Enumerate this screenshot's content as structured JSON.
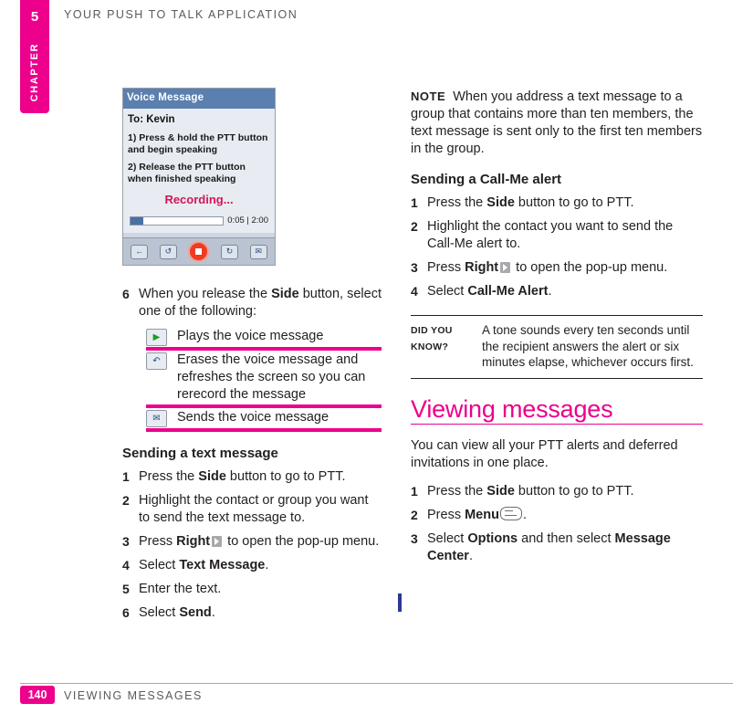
{
  "chapter": {
    "number": "5",
    "word": "CHAPTER"
  },
  "running_head": "Your Push To Talk Application",
  "figure": {
    "titlebar": "Voice Message",
    "to_line": "To: Kevin",
    "step1": "1) Press & hold the PTT button and begin speaking",
    "step2": "2) Release the PTT button when finished speaking",
    "recording_label": "Recording...",
    "time": "0:05 | 2:00",
    "buttons": [
      "back-button",
      "rewind-button",
      "record-button",
      "forward-button",
      "mail-button"
    ]
  },
  "left": {
    "step6": {
      "num": "6",
      "text_a": "When you release the ",
      "bold": "Side",
      "text_b": " button, select one of the following:"
    },
    "icon_rows": [
      {
        "icon": "play-icon",
        "glyph": "▶",
        "desc": "Plays the voice message"
      },
      {
        "icon": "erase-icon",
        "glyph": "↶",
        "desc": "Erases the voice message and refreshes the screen so you can rerecord the message"
      },
      {
        "icon": "send-icon",
        "glyph": "✉",
        "desc": "Sends the voice message"
      }
    ],
    "heading": "Sending a text message",
    "steps": [
      {
        "num": "1",
        "parts": [
          {
            "t": "Press the "
          },
          {
            "b": "Side"
          },
          {
            "t": " button to go to PTT."
          }
        ]
      },
      {
        "num": "2",
        "parts": [
          {
            "t": "Highlight the contact or group you want to send the text message to."
          }
        ]
      },
      {
        "num": "3",
        "parts": [
          {
            "t": "Press "
          },
          {
            "b": "Right"
          },
          {
            "icon": "nav-right-icon"
          },
          {
            "t": " to open the pop-up menu."
          }
        ]
      },
      {
        "num": "4",
        "parts": [
          {
            "t": "Select "
          },
          {
            "b": "Text Message"
          },
          {
            "t": "."
          }
        ]
      },
      {
        "num": "5",
        "parts": [
          {
            "t": "Enter the text."
          }
        ]
      },
      {
        "num": "6",
        "parts": [
          {
            "t": "Select "
          },
          {
            "b": "Send"
          },
          {
            "t": "."
          }
        ]
      }
    ]
  },
  "right": {
    "note_label": "NOTE",
    "note_text": "When you address a text message to a group that contains more than ten members, the text message is sent only to the first ten members in the group.",
    "heading": "Sending a Call-Me alert",
    "steps": [
      {
        "num": "1",
        "parts": [
          {
            "t": "Press the "
          },
          {
            "b": "Side"
          },
          {
            "t": " button to go to PTT."
          }
        ]
      },
      {
        "num": "2",
        "parts": [
          {
            "t": "Highlight the contact you want to send the Call-Me alert to."
          }
        ]
      },
      {
        "num": "3",
        "parts": [
          {
            "t": "Press "
          },
          {
            "b": "Right"
          },
          {
            "icon": "nav-right-icon"
          },
          {
            "t": " to open the pop-up menu."
          }
        ]
      },
      {
        "num": "4",
        "parts": [
          {
            "t": "Select "
          },
          {
            "b": "Call-Me Alert"
          },
          {
            "t": "."
          }
        ]
      }
    ],
    "tip_label": "DID YOU KNOW?",
    "tip_text": "A tone sounds every ten seconds until the recipient answers the alert or six minutes elapse, whichever occurs first.",
    "major_heading": "Viewing messages",
    "intro": "You can view all your PTT alerts and deferred invitations in one place.",
    "steps2": [
      {
        "num": "1",
        "parts": [
          {
            "t": "Press the "
          },
          {
            "b": "Side"
          },
          {
            "t": " button to go to PTT."
          }
        ]
      },
      {
        "num": "2",
        "parts": [
          {
            "t": "Press "
          },
          {
            "b": "Menu"
          },
          {
            "icon": "menu-key-icon"
          },
          {
            "t": "."
          }
        ]
      },
      {
        "num": "3",
        "parts": [
          {
            "t": "Select "
          },
          {
            "b": "Options"
          },
          {
            "t": " and then select "
          },
          {
            "b": "Message Center"
          },
          {
            "t": "."
          }
        ]
      }
    ]
  },
  "footer": {
    "page_number": "140",
    "text": "Viewing messages"
  },
  "colors": {
    "accent": "#ec008c",
    "change_bar": "#2b3990"
  }
}
